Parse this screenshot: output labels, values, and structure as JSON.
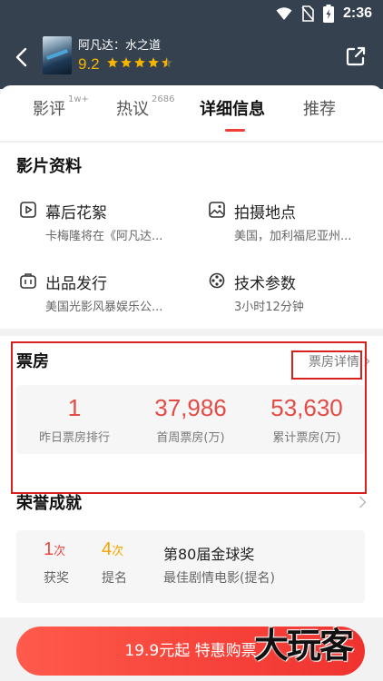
{
  "statusbar": {
    "time": "2:36"
  },
  "header": {
    "movie_title": "阿凡达：水之道",
    "rating": "9.2",
    "stars": 5
  },
  "tabs": [
    {
      "label": "影评",
      "sup": "1w+"
    },
    {
      "label": "热议",
      "sup": "2686"
    },
    {
      "label": "详细信息",
      "sup": ""
    },
    {
      "label": "推荐",
      "sup": ""
    }
  ],
  "info": {
    "title": "影片资料",
    "items": [
      {
        "title": "幕后花絮",
        "value": "卡梅隆将在《阿凡达...",
        "icon": "play-icon"
      },
      {
        "title": "拍摄地点",
        "value": "美国，加利福尼亚州...",
        "icon": "picture-icon"
      },
      {
        "title": "出品发行",
        "value": "美国光影风暴娱乐公...",
        "icon": "briefcase-icon"
      },
      {
        "title": "技术参数",
        "value": "3小时12分钟",
        "icon": "film-reel-icon"
      }
    ]
  },
  "box_office": {
    "title": "票房",
    "link": "票房详情",
    "stats": [
      {
        "value": "1",
        "label": "昨日票房排行"
      },
      {
        "value": "37,986",
        "label": "首周票房(万)"
      },
      {
        "value": "53,630",
        "label": "累计票房(万)"
      }
    ]
  },
  "honors": {
    "title": "荣誉成就",
    "wins": {
      "count": "1",
      "unit": "次",
      "label": "获奖"
    },
    "noms": {
      "count": "4",
      "unit": "次",
      "label": "提名"
    },
    "award": {
      "name": "第80届金球奖",
      "detail": "最佳剧情电影(提名)"
    }
  },
  "buy_button": {
    "label": "19.9元起 特惠购票"
  },
  "watermark": "大玩客",
  "colors": {
    "accent": "#f03d37",
    "header_bg": "#36414f",
    "star": "#f5b400"
  }
}
